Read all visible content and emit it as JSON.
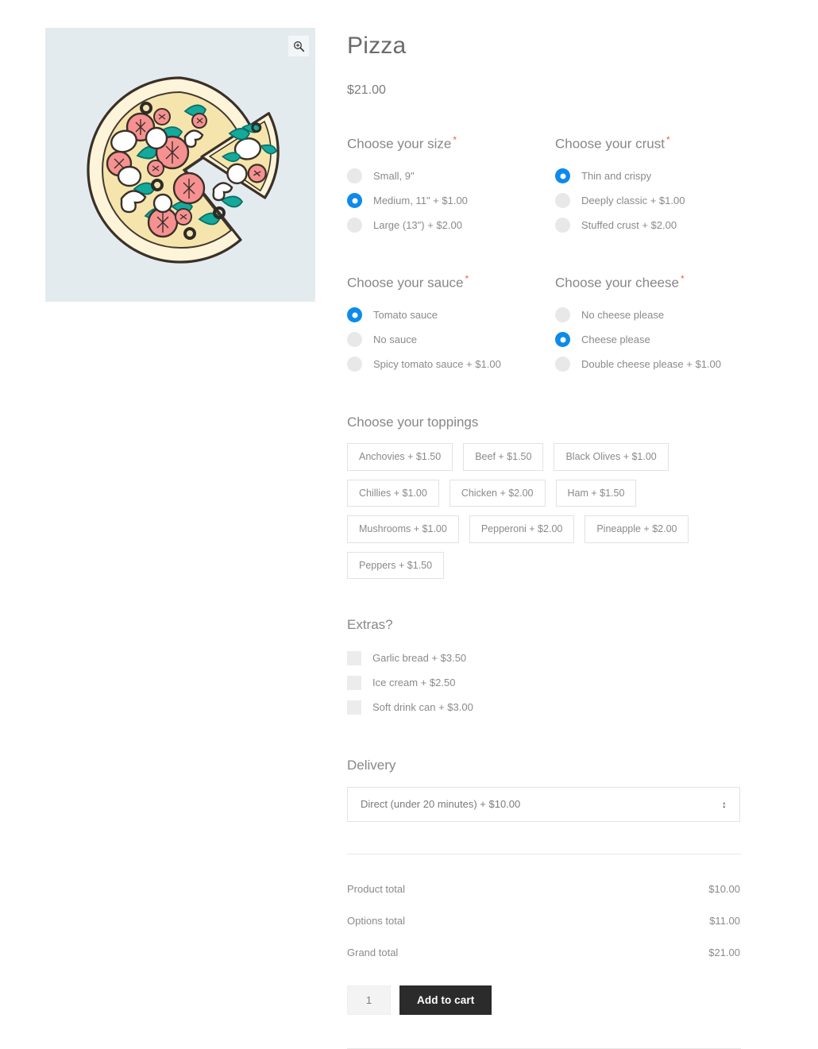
{
  "product": {
    "title": "Pizza",
    "price": "$21.00",
    "image_alt": "pizza-illustration",
    "zoom_icon": "magnifier-plus-icon"
  },
  "option_groups": [
    {
      "id": "size",
      "label": "Choose your size",
      "required": true,
      "required_mark": "*",
      "type": "radio",
      "options": [
        {
          "label": "Small, 9\"",
          "checked": false
        },
        {
          "label": "Medium, 11\" + $1.00",
          "checked": true
        },
        {
          "label": "Large (13\") + $2.00",
          "checked": false
        }
      ]
    },
    {
      "id": "crust",
      "label": "Choose your crust",
      "required": true,
      "required_mark": "*",
      "type": "radio",
      "options": [
        {
          "label": "Thin and crispy",
          "checked": true
        },
        {
          "label": "Deeply classic + $1.00",
          "checked": false
        },
        {
          "label": "Stuffed crust + $2.00",
          "checked": false
        }
      ]
    },
    {
      "id": "sauce",
      "label": "Choose your sauce",
      "required": true,
      "required_mark": "*",
      "type": "radio",
      "options": [
        {
          "label": "Tomato sauce",
          "checked": true
        },
        {
          "label": "No sauce",
          "checked": false
        },
        {
          "label": "Spicy tomato sauce + $1.00",
          "checked": false
        }
      ]
    },
    {
      "id": "cheese",
      "label": "Choose your cheese",
      "required": true,
      "required_mark": "*",
      "type": "radio",
      "options": [
        {
          "label": "No cheese please",
          "checked": false
        },
        {
          "label": "Cheese please",
          "checked": true
        },
        {
          "label": "Double cheese please + $1.00",
          "checked": false
        }
      ]
    }
  ],
  "toppings": {
    "label": "Choose your toppings",
    "items": [
      "Anchovies + $1.50",
      "Beef + $1.50",
      "Black Olives + $1.00",
      "Chillies + $1.00",
      "Chicken + $2.00",
      "Ham + $1.50",
      "Mushrooms + $1.00",
      "Pepperoni + $2.00",
      "Pineapple + $2.00",
      "Peppers + $1.50"
    ]
  },
  "extras": {
    "label": "Extras?",
    "items": [
      {
        "label": "Garlic bread + $3.50",
        "checked": false
      },
      {
        "label": "Ice cream + $2.50",
        "checked": false
      },
      {
        "label": "Soft drink can + $3.00",
        "checked": false
      }
    ]
  },
  "delivery": {
    "label": "Delivery",
    "selected": "Direct (under 20 minutes) + $10.00",
    "arrow": "↕"
  },
  "totals": [
    {
      "label": "Product total",
      "value": "$10.00"
    },
    {
      "label": "Options total",
      "value": "$11.00"
    },
    {
      "label": "Grand total",
      "value": "$21.00"
    }
  ],
  "cart": {
    "quantity": "1",
    "add_label": "Add to cart"
  },
  "colors": {
    "accent_blue": "#0d8aeb",
    "required_mark": "#e2683c",
    "button_dark": "#2b2b2b",
    "image_bg": "#e4ebef",
    "text_gray": "#8a8a8a"
  }
}
